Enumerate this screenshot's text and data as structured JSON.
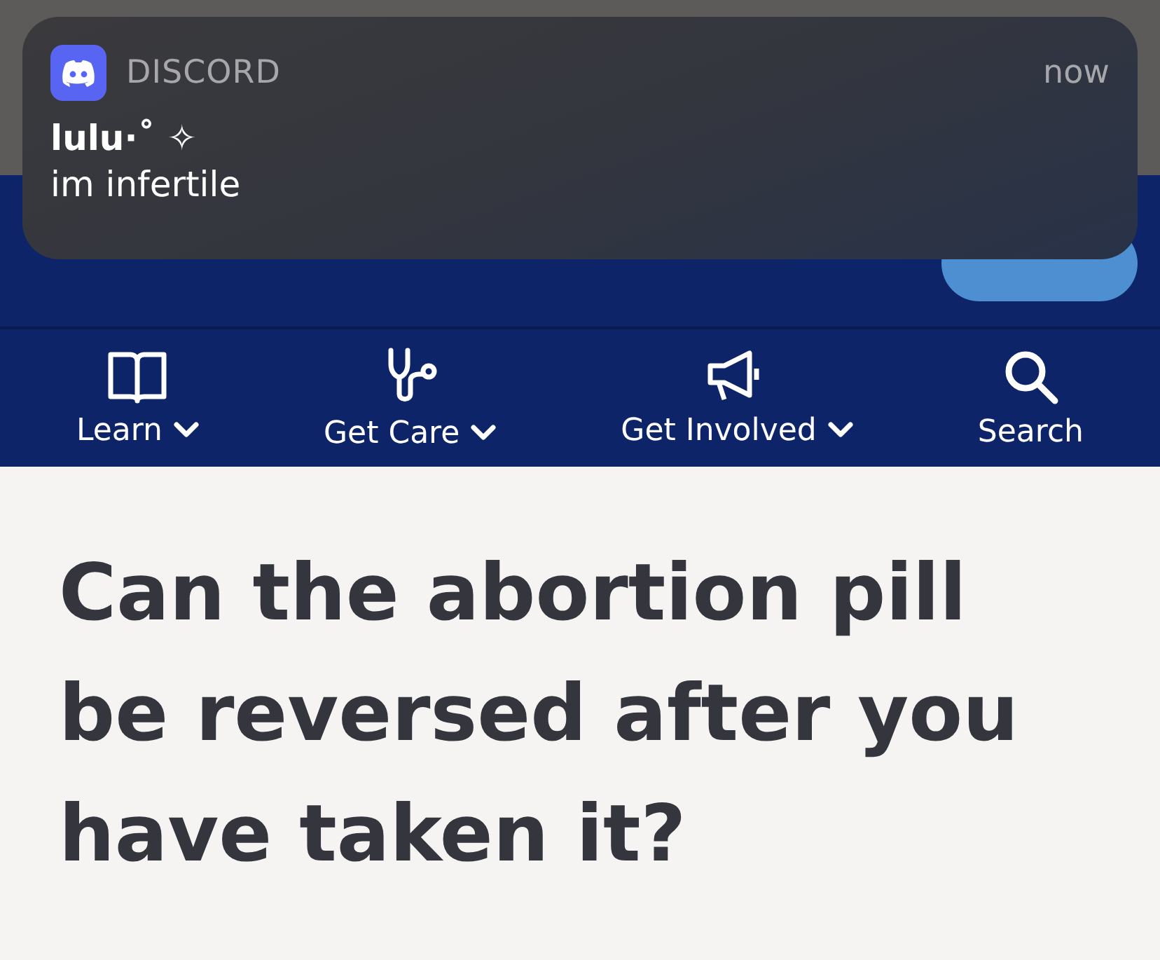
{
  "notification": {
    "app": "DISCORD",
    "time": "now",
    "sender": "lulu·˚ ✧",
    "message": "im infertile"
  },
  "nav": {
    "items": [
      {
        "kind": "book",
        "label": "Learn",
        "dropdown": true
      },
      {
        "kind": "stethoscope",
        "label": "Get Care",
        "dropdown": true
      },
      {
        "kind": "megaphone",
        "label": "Get Involved",
        "dropdown": true
      },
      {
        "kind": "search",
        "label": "Search",
        "dropdown": false
      }
    ]
  },
  "article": {
    "title": "Can the abortion pill be reversed after you have taken it?"
  }
}
